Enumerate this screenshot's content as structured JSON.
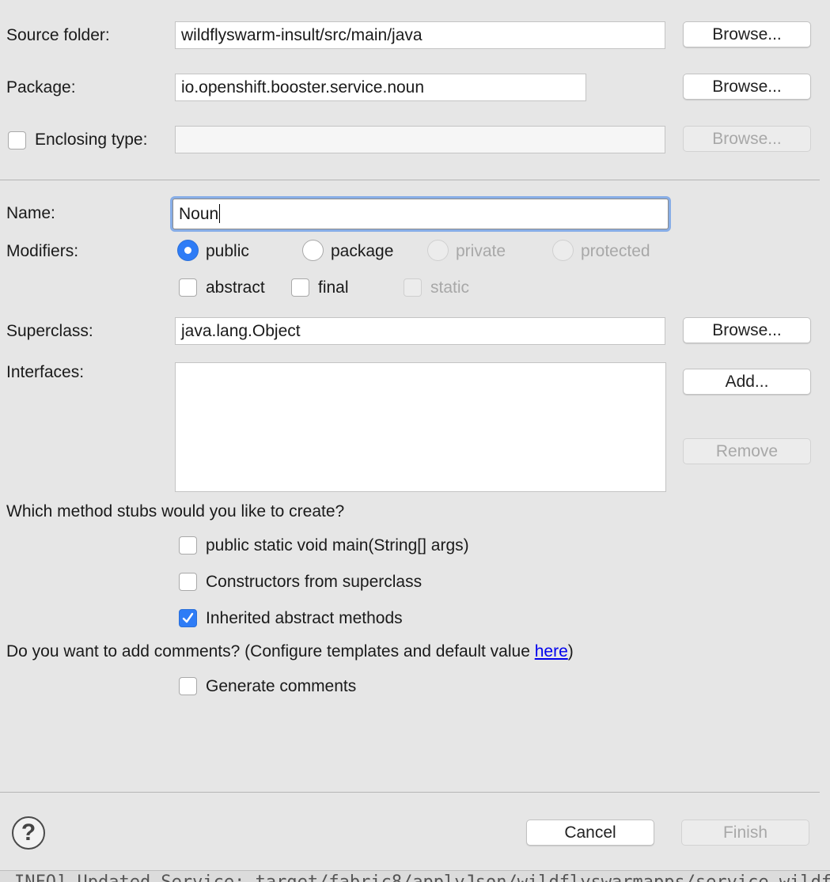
{
  "form": {
    "source_folder": {
      "label": "Source folder:",
      "value": "wildflyswarm-insult/src/main/java",
      "browse": "Browse..."
    },
    "package": {
      "label": "Package:",
      "value": "io.openshift.booster.service.noun",
      "browse": "Browse..."
    },
    "enclosing_type": {
      "label": "Enclosing type:",
      "value": "",
      "checked": false,
      "browse": "Browse..."
    },
    "name": {
      "label": "Name:",
      "value": "Noun"
    },
    "modifiers": {
      "label": "Modifiers:",
      "public": "public",
      "package": "package",
      "private": "private",
      "protected": "protected",
      "selected": "public",
      "abstract": "abstract",
      "final": "final",
      "static": "static"
    },
    "superclass": {
      "label": "Superclass:",
      "value": "java.lang.Object",
      "browse": "Browse..."
    },
    "interfaces": {
      "label": "Interfaces:",
      "add": "Add...",
      "remove": "Remove",
      "items": []
    },
    "stubs": {
      "question": "Which method stubs would you like to create?",
      "main": "public static void main(String[] args)",
      "constructors": "Constructors from superclass",
      "inherited": "Inherited abstract methods",
      "checked": {
        "main": false,
        "constructors": false,
        "inherited": true
      }
    },
    "comments": {
      "question": "Do you want to add comments? (Configure templates and default value ",
      "link": "here",
      "close": ")",
      "generate": "Generate comments",
      "checked": false
    }
  },
  "footer": {
    "help": "?",
    "cancel": "Cancel",
    "finish": "Finish"
  },
  "console": {
    "text": "INFO] Updated Service: target/fabric8/applyJson/wildflyswarmapps/service-wildfl"
  },
  "colors": {
    "accent": "#2e7cf6",
    "focus_ring": "#88aee7",
    "link": "#0000ee"
  }
}
